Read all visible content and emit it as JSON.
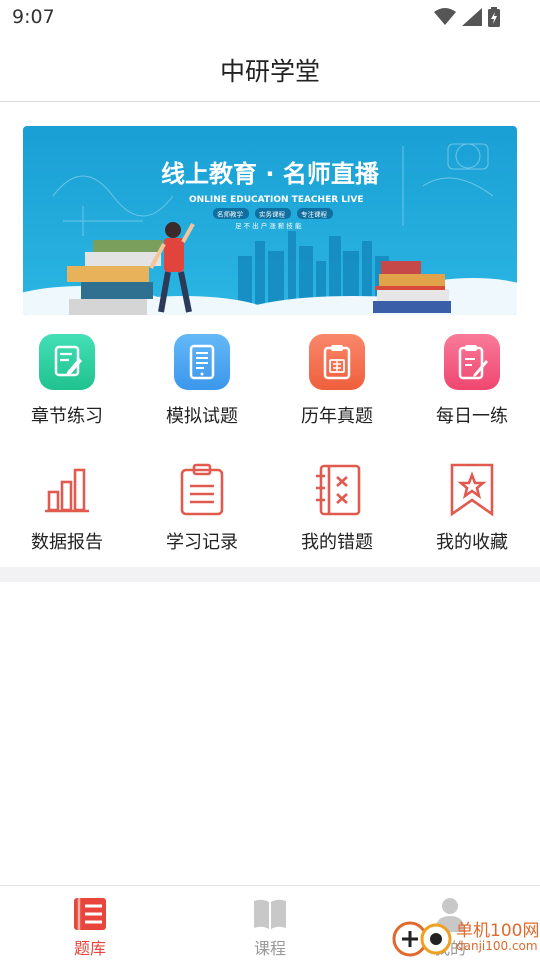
{
  "status_bar": {
    "time": "9:07"
  },
  "header": {
    "title": "中研学堂"
  },
  "banner": {
    "headline": "线上教育 · 名师直播",
    "subtitle": "ONLINE EDUCATION TEACHER LIVE",
    "tags": [
      "名师教学",
      "实务课程",
      "专注课程"
    ],
    "tagline": "足 不 出 户 涨 薪 技 能"
  },
  "features_top": [
    {
      "label": "章节练习",
      "icon": "pencil-note-icon",
      "color": "#2fcf9f"
    },
    {
      "label": "模拟试题",
      "icon": "tablet-doc-icon",
      "color": "#4aa8f0"
    },
    {
      "label": "历年真题",
      "icon": "clipboard-zhen-icon",
      "color": "#f57451"
    },
    {
      "label": "每日一练",
      "icon": "edit-doc-icon",
      "color": "#f4557a"
    }
  ],
  "features_bottom": [
    {
      "label": "数据报告",
      "icon": "bar-chart-icon"
    },
    {
      "label": "学习记录",
      "icon": "clipboard-list-icon"
    },
    {
      "label": "我的错题",
      "icon": "wrong-notebook-icon"
    },
    {
      "label": "我的收藏",
      "icon": "star-bookmark-icon"
    }
  ],
  "tabs": [
    {
      "label": "题库",
      "icon": "question-bank-icon",
      "active": true
    },
    {
      "label": "课程",
      "icon": "open-book-icon",
      "active": false
    },
    {
      "label": "我的",
      "icon": "person-icon",
      "active": false
    }
  ],
  "watermark": {
    "line1": "单机100网",
    "line2": "danji100.com"
  },
  "colors": {
    "accent": "#e8453c",
    "line_icon": "#e05a4f",
    "inactive": "#999999",
    "band": "#f2f2f5"
  }
}
